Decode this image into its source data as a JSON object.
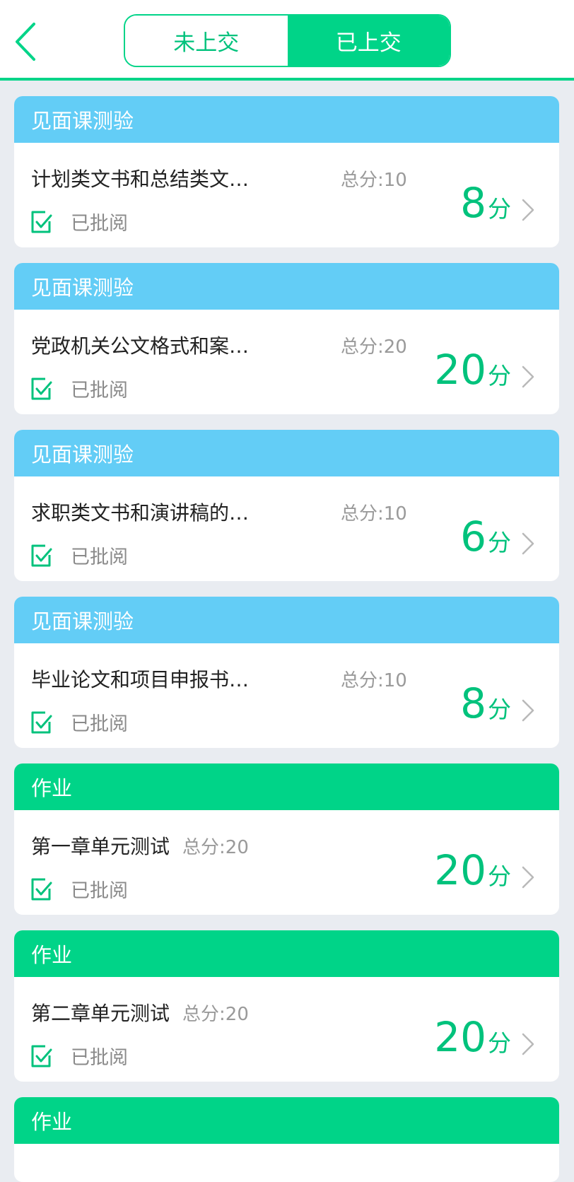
{
  "header": {
    "tabs": [
      {
        "label": "未上交",
        "active": false
      },
      {
        "label": "已上交",
        "active": true
      }
    ],
    "back_icon": "chevron-left-icon"
  },
  "colors": {
    "accent": "#00d488",
    "score": "#00c27c",
    "header_blue": "#63cdf6",
    "background": "#e9ecf1"
  },
  "items": [
    {
      "category": "见面课测验",
      "title": "计划类文书和总结类文…",
      "total": "总分:10",
      "status": "已批阅",
      "score": "8",
      "unit": "分"
    },
    {
      "category": "见面课测验",
      "title": "党政机关公文格式和案…",
      "total": "总分:20",
      "status": "已批阅",
      "score": "20",
      "unit": "分"
    },
    {
      "category": "见面课测验",
      "title": "求职类文书和演讲稿的…",
      "total": "总分:10",
      "status": "已批阅",
      "score": "6",
      "unit": "分"
    },
    {
      "category": "见面课测验",
      "title": "毕业论文和项目申报书…",
      "total": "总分:10",
      "status": "已批阅",
      "score": "8",
      "unit": "分"
    },
    {
      "category": "作业",
      "title": "第一章单元测试",
      "total": "总分:20",
      "status": "已批阅",
      "score": "20",
      "unit": "分"
    },
    {
      "category": "作业",
      "title": "第二章单元测试",
      "total": "总分:20",
      "status": "已批阅",
      "score": "20",
      "unit": "分"
    },
    {
      "category": "作业"
    }
  ]
}
